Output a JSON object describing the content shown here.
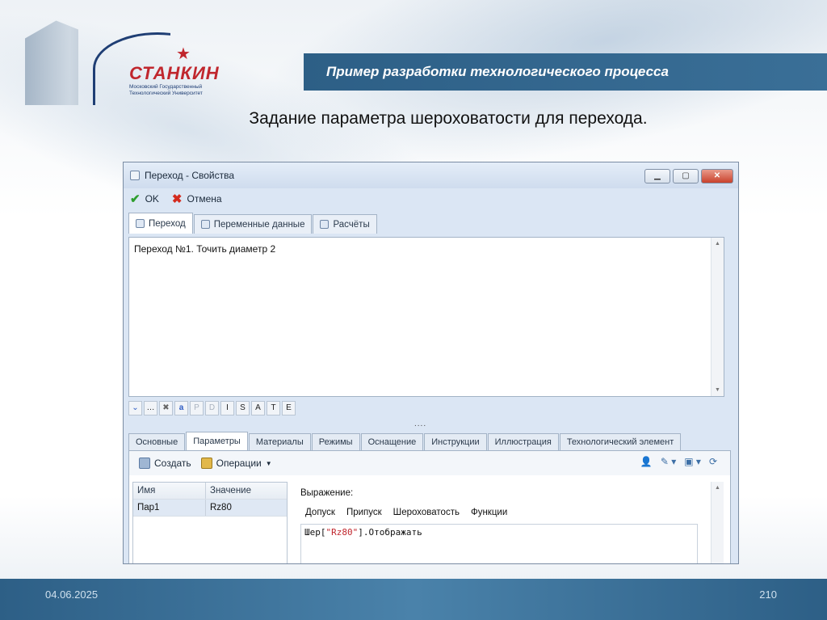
{
  "slide": {
    "header_title": "Пример разработки технологического процесса",
    "subtitle": "Задание параметра шероховатости для перехода.",
    "date": "04.06.2025",
    "page_number": "210",
    "logo": {
      "name": "СТАНКИН",
      "subtitle": "Московский Государственный Технологический Университет"
    }
  },
  "window": {
    "title": "Переход - Свойства",
    "toolbar": {
      "ok_label": "OK",
      "cancel_label": "Отмена"
    },
    "tabs": [
      {
        "label": "Переход",
        "active": true
      },
      {
        "label": "Переменные данные",
        "active": false
      },
      {
        "label": "Расчёты",
        "active": false
      }
    ],
    "editor_text": "Переход №1. Точить диаметр 2",
    "format_buttons": [
      "P",
      "D",
      "I",
      "S",
      "A",
      "T",
      "E"
    ],
    "bottom_tabs": [
      {
        "label": "Основные",
        "active": false
      },
      {
        "label": "Параметры",
        "active": true
      },
      {
        "label": "Материалы",
        "active": false
      },
      {
        "label": "Режимы",
        "active": false
      },
      {
        "label": "Оснащение",
        "active": false
      },
      {
        "label": "Инструкции",
        "active": false
      },
      {
        "label": "Иллюстрация",
        "active": false
      },
      {
        "label": "Технологический элемент",
        "active": false
      }
    ],
    "panel": {
      "create_label": "Создать",
      "operations_label": "Операции",
      "grid_headers": [
        "Имя",
        "Значение"
      ],
      "grid_rows": [
        {
          "name": "Пар1",
          "value": "Rz80"
        }
      ],
      "expression_label": "Выражение:",
      "expression_tabs": [
        "Допуск",
        "Припуск",
        "Шероховатость",
        "Функции"
      ],
      "code": {
        "prefix": "Шер[",
        "string": "\"Rz80\"",
        "suffix": "].Отображать"
      }
    }
  },
  "colors": {
    "header_bar": "#2d5f86",
    "accent_red": "#c0262d",
    "logo_blue": "#1f3e74"
  }
}
